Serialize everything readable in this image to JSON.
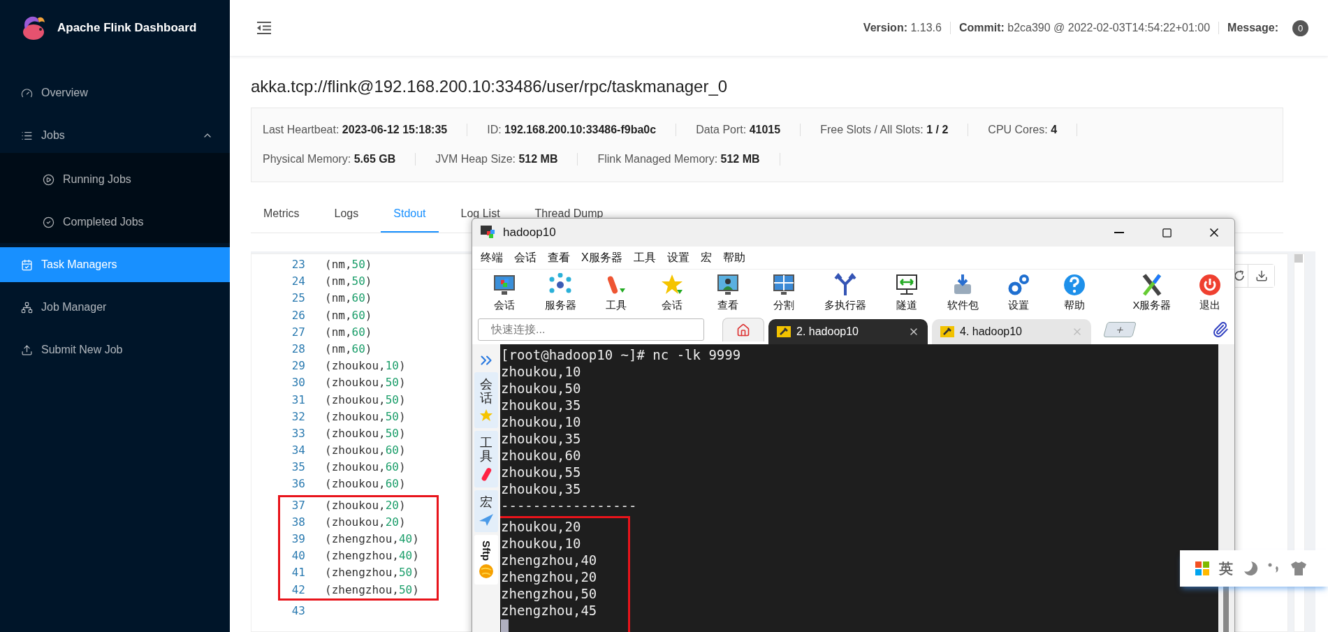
{
  "sidebar": {
    "brand": "Apache Flink Dashboard",
    "items": [
      {
        "label": "Overview",
        "selected": false
      },
      {
        "label": "Jobs",
        "selected": false,
        "expanded": true,
        "children": [
          {
            "label": "Running Jobs",
            "selected": false
          },
          {
            "label": "Completed Jobs",
            "selected": false
          }
        ]
      },
      {
        "label": "Task Managers",
        "selected": true
      },
      {
        "label": "Job Manager",
        "selected": false
      },
      {
        "label": "Submit New Job",
        "selected": false
      }
    ]
  },
  "header": {
    "items": [
      "**Version:** 1.13.6",
      "**Commit:** b2ca390 @ 2022-02-03T14:54:22+01:00",
      "**Message:**"
    ],
    "message_count": "0"
  },
  "title": "akka.tcp://flink@192.168.200.10:33486/user/rpc/taskmanager_0",
  "info": [
    [
      "Last Heartbeat:  **2023-06-12 15:18:35**",
      "ID:  **192.168.200.10:33486-f9ba0c**",
      "Data Port:  **41015**",
      "Free Slots / All Slots:  **1 / 2**",
      "CPU Cores:  **4**"
    ],
    [
      "Physical Memory:  **5.65 GB**",
      "JVM Heap Size:  **512 MB**",
      "Flink Managed Memory:  **512 MB**"
    ]
  ],
  "tabs": [
    {
      "label": "Metrics",
      "selected": false
    },
    {
      "label": "Logs",
      "selected": false
    },
    {
      "label": "Stdout",
      "selected": true
    },
    {
      "label": "Log List",
      "selected": false
    },
    {
      "label": "Thread Dump",
      "selected": false
    }
  ],
  "stdout": {
    "blocks": [
      {
        "lines": [
          {
            "number": "23",
            "head": "(nm,",
            "value": "50",
            "tail": ")"
          },
          {
            "number": "24",
            "head": "(nm,",
            "value": "50",
            "tail": ")"
          },
          {
            "number": "25",
            "head": "(nm,",
            "value": "60",
            "tail": ")"
          },
          {
            "number": "26",
            "head": "(nm,",
            "value": "60",
            "tail": ")"
          },
          {
            "number": "27",
            "head": "(nm,",
            "value": "60",
            "tail": ")"
          },
          {
            "number": "28",
            "head": "(nm,",
            "value": "60",
            "tail": ")"
          },
          {
            "number": "29",
            "head": "(zhoukou,",
            "value": "10",
            "tail": ")"
          },
          {
            "number": "30",
            "head": "(zhoukou,",
            "value": "50",
            "tail": ")"
          },
          {
            "number": "31",
            "head": "(zhoukou,",
            "value": "50",
            "tail": ")"
          },
          {
            "number": "32",
            "head": "(zhoukou,",
            "value": "50",
            "tail": ")"
          },
          {
            "number": "33",
            "head": "(zhoukou,",
            "value": "50",
            "tail": ")"
          },
          {
            "number": "34",
            "head": "(zhoukou,",
            "value": "60",
            "tail": ")"
          },
          {
            "number": "35",
            "head": "(zhoukou,",
            "value": "60",
            "tail": ")"
          },
          {
            "number": "36",
            "head": "(zhoukou,",
            "value": "60",
            "tail": ")"
          }
        ]
      },
      {
        "highlighted": true,
        "lines": [
          {
            "number": "37",
            "head": "(zhoukou,",
            "value": "20",
            "tail": ")"
          },
          {
            "number": "38",
            "head": "(zhoukou,",
            "value": "20",
            "tail": ")"
          },
          {
            "number": "39",
            "head": "(zhengzhou,",
            "value": "40",
            "tail": ")"
          },
          {
            "number": "40",
            "head": "(zhengzhou,",
            "value": "40",
            "tail": ")"
          },
          {
            "number": "41",
            "head": "(zhengzhou,",
            "value": "50",
            "tail": ")"
          },
          {
            "number": "42",
            "head": "(zhengzhou,",
            "value": "50",
            "tail": ")"
          }
        ]
      },
      {
        "lines": [
          {
            "number": "43"
          }
        ]
      }
    ]
  },
  "terminal": {
    "title": "hadoop10",
    "menu": [
      "终端",
      "会话",
      "查看",
      "X服务器",
      "工具",
      "设置",
      "宏",
      "帮助"
    ],
    "toolbar_left": [
      "会话",
      "服务器",
      "工具",
      "会话",
      "查看",
      "分割",
      "多执行器",
      "隧道",
      "软件包",
      "设置",
      "帮助"
    ],
    "toolbar_right": [
      "X服务器",
      "退出"
    ],
    "quick_connect": {
      "placeholder": "快速连接..."
    },
    "tabs": [
      {
        "label": "2. hadoop10",
        "selected": true
      },
      {
        "label": "4. hadoop10",
        "selected": false
      }
    ],
    "side_tabs": [
      {
        "label": "会话",
        "kind": "stacked"
      },
      {
        "label": "工具",
        "kind": "stacked"
      },
      {
        "label": "宏",
        "kind": "stacked"
      },
      {
        "label": "Sftp",
        "kind": "rotated"
      }
    ],
    "blocks": [
      {
        "lines": [
          "[root@hadoop10 ~]# nc -lk 9999",
          "zhoukou,10",
          "zhoukou,50",
          "zhoukou,35",
          "zhoukou,10",
          "zhoukou,35",
          "zhoukou,60",
          "zhoukou,55",
          "zhoukou,35",
          "-----------------"
        ]
      },
      {
        "highlighted": true,
        "lines": [
          "zhoukou,20",
          "zhoukou,10",
          "zhengzhou,40",
          "zhengzhou,20",
          "zhengzhou,50",
          "zhengzhou,45"
        ]
      }
    ],
    "cursor": true
  },
  "ime": {
    "mode": "英"
  }
}
